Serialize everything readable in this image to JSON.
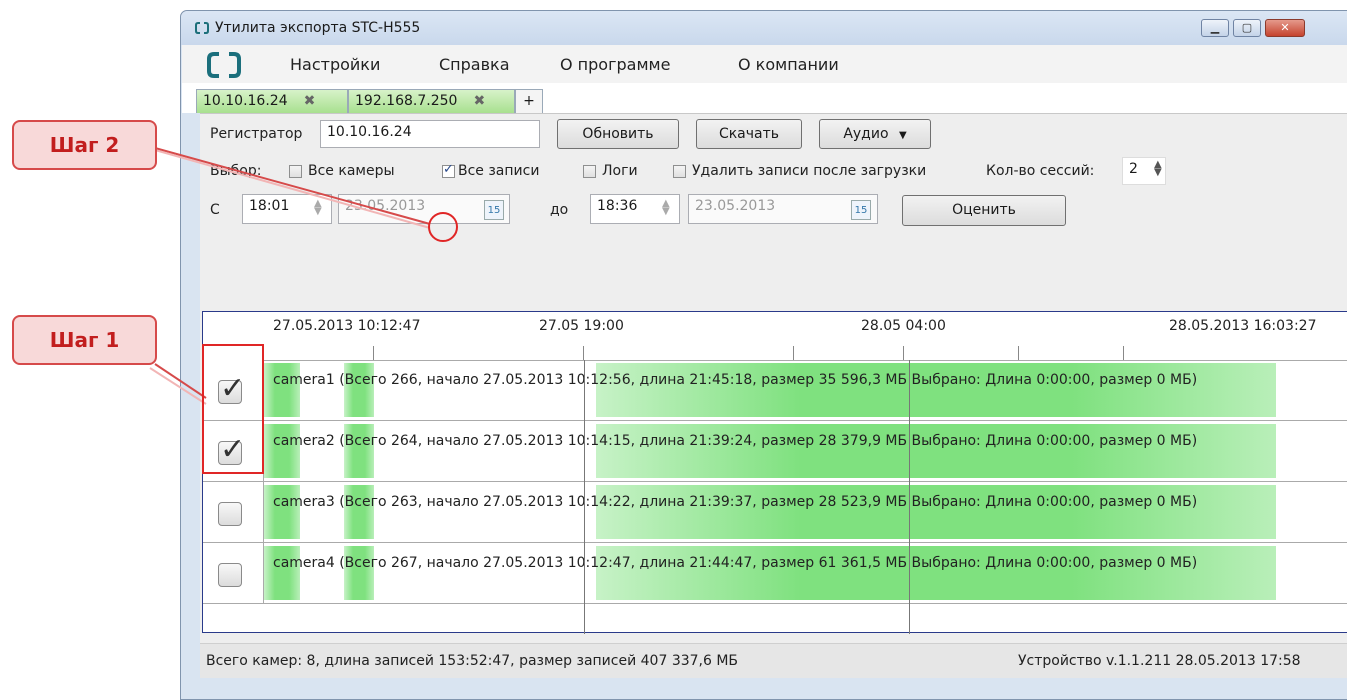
{
  "window": {
    "title": "Утилита экспорта STC-H555"
  },
  "menu": [
    "Настройки",
    "Справка",
    "О программе",
    "О компании"
  ],
  "tabs": [
    {
      "label": "10.10.16.24",
      "close": "✖"
    },
    {
      "label": "192.168.7.250",
      "close": "✖"
    },
    {
      "label": "+"
    }
  ],
  "registrar": {
    "label": "Регистратор",
    "value": "10.10.16.24"
  },
  "buttons": {
    "refresh": "Обновить",
    "download": "Скачать",
    "audio": "Аудио",
    "audio_arrow": "▼",
    "estimate": "Оценить"
  },
  "selection": {
    "label": "Выбор:",
    "all_cameras": {
      "label": "Все камеры",
      "checked": false
    },
    "all_records": {
      "label": "Все записи",
      "checked": true
    },
    "logs": {
      "label": "Логи",
      "checked": false
    },
    "delete_after": {
      "label": "Удалить записи после загрузки",
      "checked": false
    },
    "sessions_label": "Кол-во сессий:",
    "sessions_value": "2"
  },
  "range": {
    "from_label": "С",
    "from_time": "18:01",
    "from_date": "23.05.2013",
    "to_label": "до",
    "to_time": "18:36",
    "to_date": "23.05.2013",
    "calendar_day": "15"
  },
  "timeline": {
    "labels": [
      "27.05.2013 10:12:47",
      "27.05 19:00",
      "28.05 04:00",
      "28.05.2013 16:03:27"
    ]
  },
  "cameras": [
    {
      "checked": true,
      "text": "camera1 (Всего 266, начало 27.05.2013 10:12:56, длина 21:45:18, размер 35 596,3 МБ Выбрано: Длина 0:00:00, размер 0 МБ)"
    },
    {
      "checked": true,
      "text": "camera2 (Всего 264, начало 27.05.2013 10:14:15, длина 21:39:24, размер 28 379,9 МБ Выбрано: Длина 0:00:00, размер 0 МБ)"
    },
    {
      "checked": false,
      "text": "camera3 (Всего 263, начало 27.05.2013 10:14:22, длина 21:39:37, размер 28 523,9 МБ Выбрано: Длина 0:00:00, размер 0 МБ)"
    },
    {
      "checked": false,
      "text": "camera4 (Всего 267, начало 27.05.2013 10:12:47, длина 21:44:47, размер 61 361,5 МБ Выбрано: Длина 0:00:00, размер 0 МБ)"
    }
  ],
  "status": {
    "left": "Всего камер: 8, длина записей 153:52:47, размер записей 407 337,6 МБ",
    "right": "Устройство v.1.1.211  28.05.2013 17:58"
  },
  "callouts": {
    "step1": "Шаг 1",
    "step2": "Шаг 2"
  },
  "colors": {
    "accent_red": "#e02626",
    "record_green": "#7fe17f",
    "tab_green": "#a8e08f"
  }
}
